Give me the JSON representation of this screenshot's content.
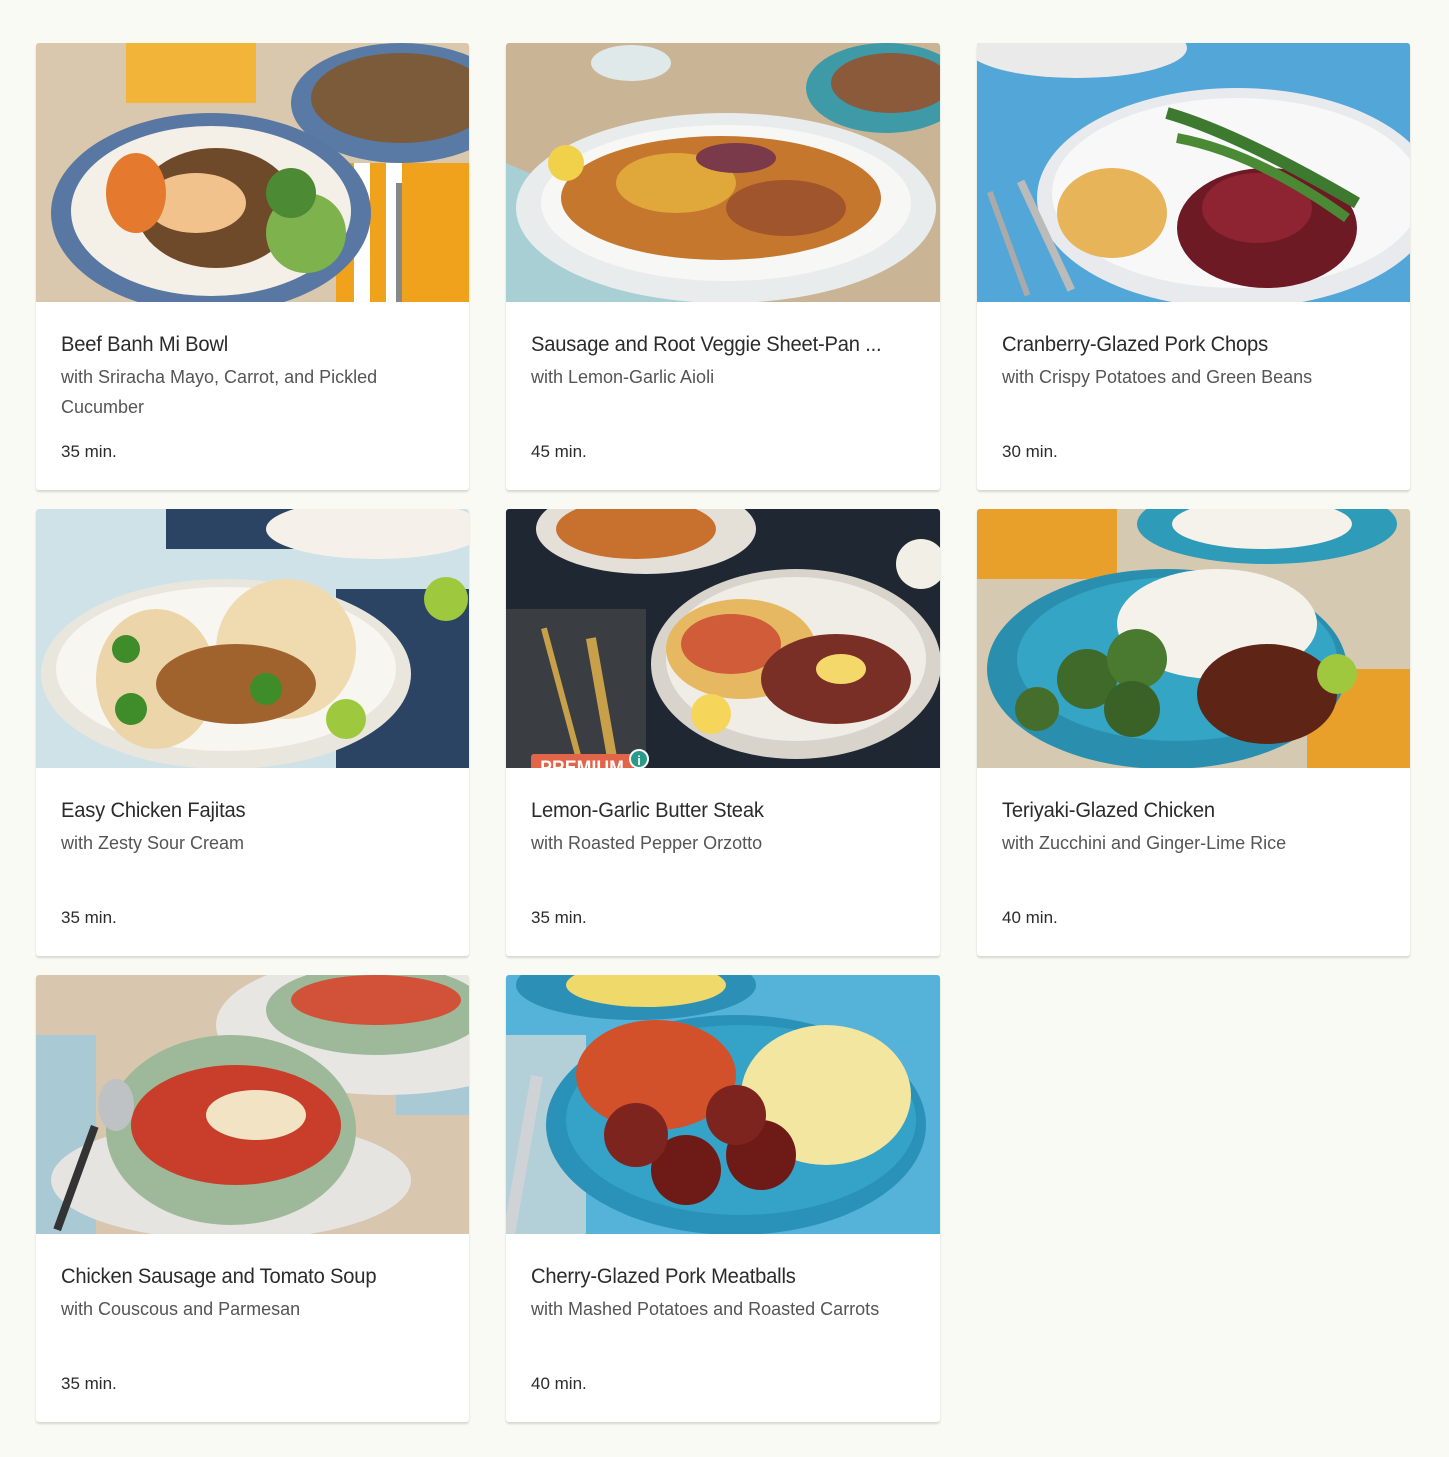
{
  "recipes": [
    {
      "title": "Beef Banh Mi Bowl",
      "subtitle": "with Sriracha Mayo, Carrot, and Pickled Cucumber",
      "time": "35 min.",
      "image": "beef-banh-mi-bowl-photo"
    },
    {
      "title": "Sausage and Root Veggie Sheet-Pan ...",
      "subtitle": "with Lemon-Garlic Aioli",
      "time": "45 min.",
      "image": "sausage-sheet-pan-photo"
    },
    {
      "title": "Cranberry-Glazed Pork Chops",
      "subtitle": "with Crispy Potatoes and Green Beans",
      "time": "30 min.",
      "image": "pork-chops-photo"
    },
    {
      "title": "Easy Chicken Fajitas",
      "subtitle": "with Zesty Sour Cream",
      "time": "35 min.",
      "image": "chicken-fajitas-photo"
    },
    {
      "title": "Lemon-Garlic Butter Steak",
      "subtitle": "with Roasted Pepper Orzotto",
      "time": "35 min.",
      "image": "butter-steak-photo",
      "badge": "PREMIUM",
      "badge_info": "i"
    },
    {
      "title": "Teriyaki-Glazed Chicken",
      "subtitle": "with Zucchini and Ginger-Lime Rice",
      "time": "40 min.",
      "image": "teriyaki-chicken-photo"
    },
    {
      "title": "Chicken Sausage and Tomato Soup",
      "subtitle": "with Couscous and Parmesan",
      "time": "35 min.",
      "image": "tomato-soup-photo"
    },
    {
      "title": "Cherry-Glazed Pork Meatballs",
      "subtitle": "with Mashed Potatoes and Roasted Carrots",
      "time": "40 min.",
      "image": "pork-meatballs-photo"
    }
  ],
  "colors": {
    "page_bg": "#fafaf4",
    "card_bg": "#ffffff",
    "premium_badge": "#e2654a",
    "info_dot": "#2a9a8a"
  }
}
